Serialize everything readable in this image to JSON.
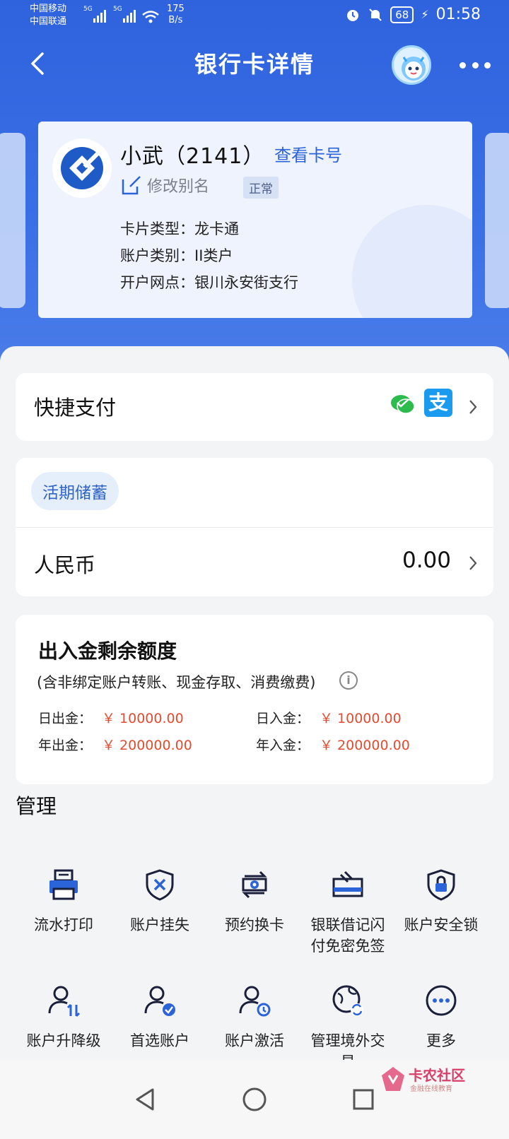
{
  "status_bar": {
    "carrier1": "中国移动",
    "carrier2": "中国联通",
    "net1": "5G",
    "net2": "5G",
    "speed_value": "175",
    "speed_unit": "B/s",
    "battery": "68",
    "time": "01:58"
  },
  "nav": {
    "title": "银行卡详情",
    "back_icon": "chevron-left-icon",
    "more_icon": "more-dots-icon"
  },
  "card": {
    "name": "小武（2141）",
    "view_number": "查看卡号",
    "edit_alias": "修改别名",
    "status": "正常",
    "type_label": "卡片类型：",
    "type_value": "龙卡通",
    "category_label": "账户类别：",
    "category_value": "II类户",
    "branch_label": "开户网点：",
    "branch_value": "银川永安街支行"
  },
  "quick_pay": {
    "label": "快捷支付",
    "icons": [
      "wechat-pay-icon",
      "alipay-icon"
    ],
    "alipay_glyph": "支"
  },
  "savings": {
    "tag": "活期储蓄",
    "currency": "人民币",
    "balance": "0.00"
  },
  "limits": {
    "title": "出入金剩余额度",
    "subtitle": "(含非绑定账户转账、现金存取、消费缴费)",
    "daily_out_label": "日出金：",
    "daily_out_value": "￥ 10000.00",
    "daily_in_label": "日入金：",
    "daily_in_value": "￥ 10000.00",
    "yearly_out_label": "年出金：",
    "yearly_out_value": "￥ 200000.00",
    "yearly_in_label": "年入金：",
    "yearly_in_value": "￥ 200000.00"
  },
  "manage": {
    "title": "管理",
    "items": [
      {
        "label": "流水打印",
        "icon": "printer-icon"
      },
      {
        "label": "账户挂失",
        "icon": "shield-x-icon"
      },
      {
        "label": "预约换卡",
        "icon": "card-swap-icon"
      },
      {
        "label": "银联借记闪付免密免签",
        "icon": "card-nfc-icon"
      },
      {
        "label": "账户安全锁",
        "icon": "shield-lock-icon"
      },
      {
        "label": "账户升降级",
        "icon": "user-updown-icon"
      },
      {
        "label": "首选账户",
        "icon": "user-check-icon"
      },
      {
        "label": "账户激活",
        "icon": "user-activate-icon"
      },
      {
        "label": "管理境外交易",
        "icon": "globe-exchange-icon"
      },
      {
        "label": "更多",
        "icon": "more-circle-icon"
      }
    ]
  },
  "watermark": {
    "title": "卡农社区",
    "subtitle": "金融在线教育"
  },
  "colors": {
    "brand_blue": "#2f63de",
    "accent_red": "#e34b2e",
    "link_blue": "#2b63d8"
  }
}
